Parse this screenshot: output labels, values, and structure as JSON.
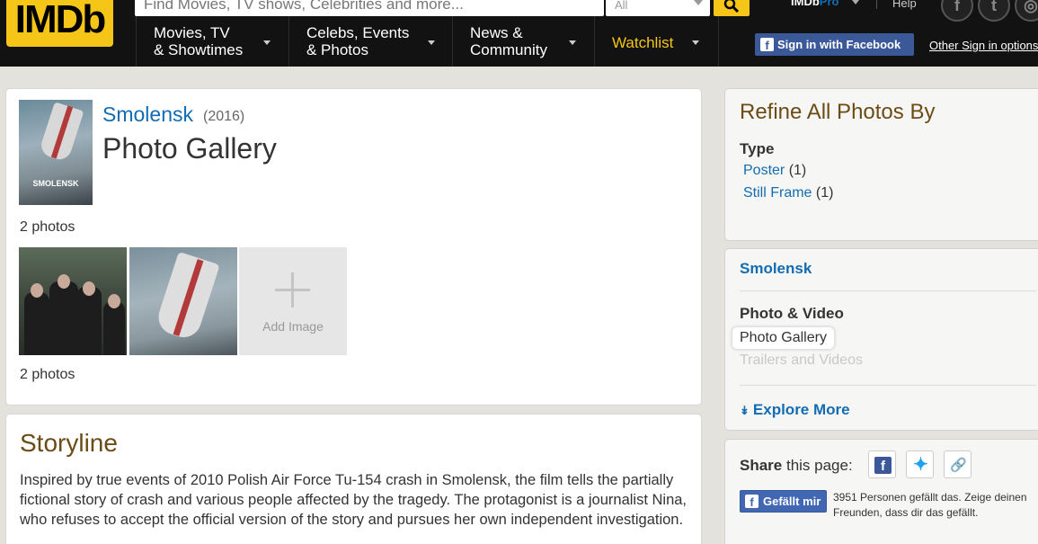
{
  "header": {
    "logo_text": "IMDb",
    "search_placeholder": "Find Movies, TV shows, Celebrities and more...",
    "search_category": "All",
    "nav": {
      "movies": [
        "Movies, TV",
        "& Showtimes"
      ],
      "celebs": [
        "Celebs, Events",
        "& Photos"
      ],
      "news": [
        "News &",
        "Community"
      ],
      "watchlist": "Watchlist"
    },
    "imdbpro": {
      "brand": "IMDb",
      "pro": "Pro"
    },
    "help": "Help",
    "social": [
      "facebook-icon",
      "twitter-icon",
      "instagram-icon"
    ],
    "fb_signin": "Sign in with Facebook",
    "other_signin": "Other Sign in options"
  },
  "gallery": {
    "poster_title": "SMOLENSK",
    "movie_title": "Smolensk",
    "year": "(2016)",
    "title": "Photo Gallery",
    "photo_count_top": "2 photos",
    "photo_count_bottom": "2 photos",
    "add_image_label": "Add Image"
  },
  "storyline": {
    "title": "Storyline",
    "text": "Inspired by true events of 2010 Polish Air Force Tu-154 crash in Smolensk, the film tells the partially fictional story of crash and various people affected by the tragedy. The protagonist is a journalist Nina, who refuses to accept the official version of the story and pursues her own independent investigation."
  },
  "refine": {
    "title": "Refine All Photos By",
    "type_label": "Type",
    "items": [
      {
        "label": "Poster",
        "count": "(1)"
      },
      {
        "label": "Still Frame",
        "count": "(1)"
      }
    ]
  },
  "related": {
    "movie": "Smolensk",
    "section_label": "Photo & Video",
    "current": "Photo Gallery",
    "trailers": "Trailers and Videos",
    "explore": "Explore More"
  },
  "share": {
    "label_bold": "Share",
    "label_rest": " this page:",
    "like_label": "Gefällt mir",
    "like_text": "3951 Personen gefällt das. Zeige deinen Freunden, dass dir das gefällt."
  },
  "colors": {
    "brand": "#f5c518",
    "link": "#136cb2",
    "heading": "#6b4c16",
    "facebook": "#3b5998"
  }
}
